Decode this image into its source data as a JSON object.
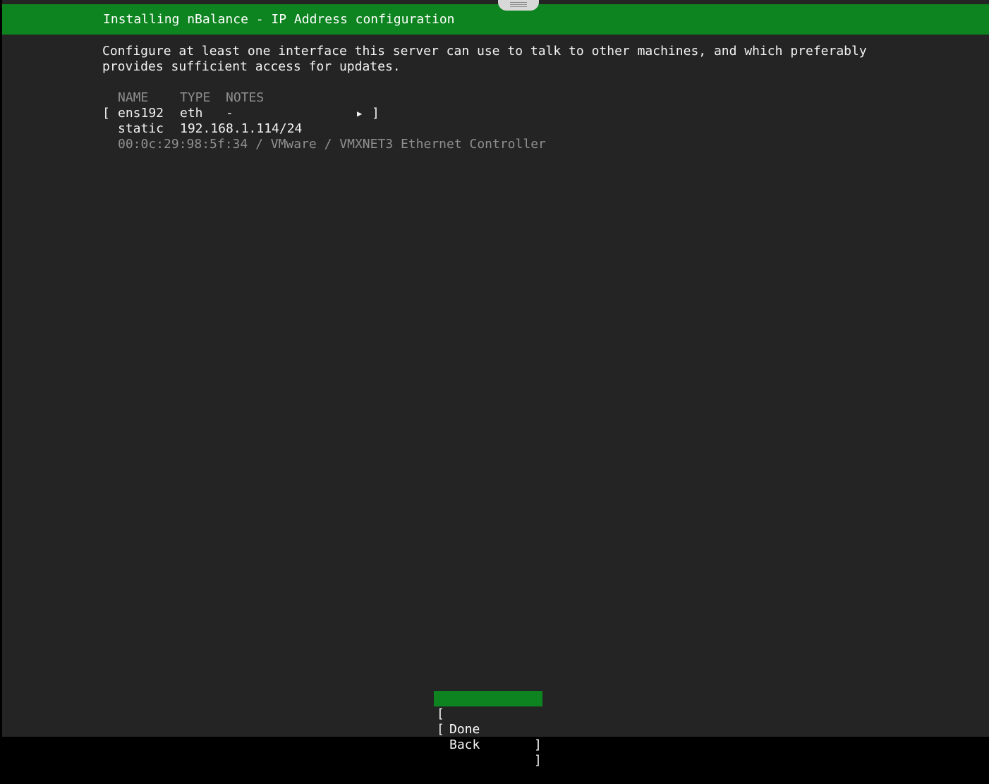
{
  "header": {
    "title": "Installing nBalance - IP Address configuration"
  },
  "description": {
    "line1": "Configure at least one interface this server can use to talk to other machines, and which preferably",
    "line2": "provides sufficient access for updates."
  },
  "table": {
    "columns": [
      "NAME",
      "TYPE",
      "NOTES"
    ],
    "interfaces": [
      {
        "open_bracket": "[",
        "name": "ens192",
        "type": "eth",
        "notes": "-",
        "menu_icon": "▶",
        "close_bracket": "]",
        "address_method": "static",
        "address": "192.168.1.114/24",
        "hardware": "00:0c:29:98:5f:34 / VMware / VMXNET3 Ethernet Controller"
      }
    ]
  },
  "buttons": {
    "open_bracket": "[",
    "close_bracket": "]",
    "done": "Done",
    "back": "Back"
  },
  "colors": {
    "accent": "#0e8420",
    "background": "#242424",
    "text": "#f2f2f2",
    "dim_text": "#8f8f8f"
  }
}
